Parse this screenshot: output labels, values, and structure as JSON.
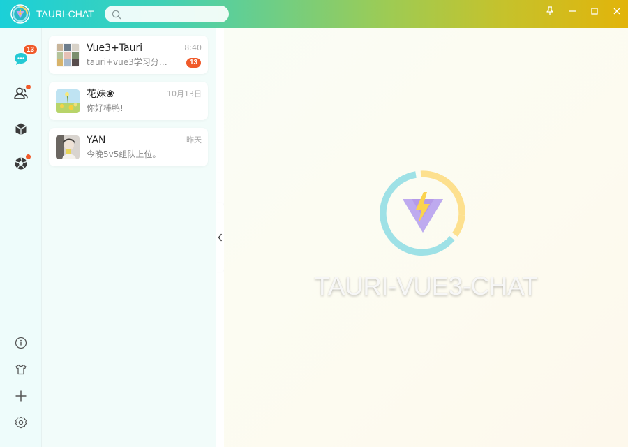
{
  "app": {
    "title": "TAURI-CHAT"
  },
  "search": {
    "placeholder": "",
    "value": ""
  },
  "window_controls": [
    "pin-icon",
    "minimize-icon",
    "maximize-icon",
    "close-icon"
  ],
  "sidebar": {
    "items": [
      {
        "name": "chat",
        "icon": "chat-bubble-icon",
        "badge": "13",
        "active": true
      },
      {
        "name": "contacts",
        "icon": "contacts-icon",
        "dot": true
      },
      {
        "name": "favorites",
        "icon": "cube-icon"
      },
      {
        "name": "moments",
        "icon": "aperture-icon",
        "dot": true
      }
    ],
    "bottom_items": [
      {
        "name": "about",
        "icon": "info-icon"
      },
      {
        "name": "skin",
        "icon": "tshirt-icon"
      },
      {
        "name": "add",
        "icon": "plus-icon"
      },
      {
        "name": "settings",
        "icon": "gear-icon"
      }
    ]
  },
  "chats": [
    {
      "name": "Vue3+Tauri",
      "time": "8:40",
      "preview": "tauri+vue3学习分享...",
      "unread": "13"
    },
    {
      "name": "花妹❀",
      "time": "10月13日",
      "preview": "你好棒鸭!",
      "unread": ""
    },
    {
      "name": "YAN",
      "time": "昨天",
      "preview": "今晚5v5组队上位。",
      "unread": ""
    }
  ],
  "main": {
    "brand_text": "TAURI-VUE3-CHAT"
  },
  "colors": {
    "badge": "#f05a2a",
    "accent": "#23c9d4",
    "titlebar_start": "#1bd0d8",
    "titlebar_end": "#e2b40a"
  }
}
